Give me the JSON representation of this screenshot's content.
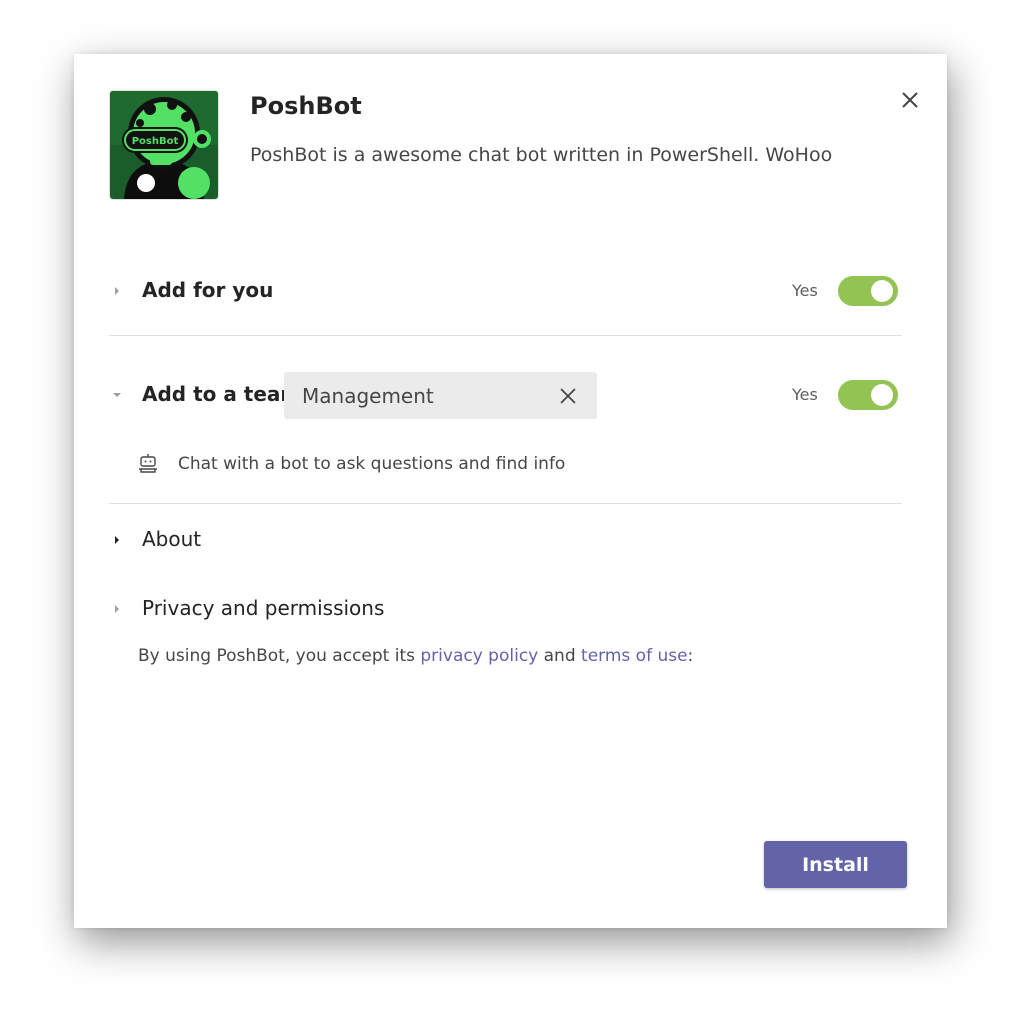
{
  "app": {
    "name": "PoshBot",
    "description": "PoshBot is a awesome chat bot written in PowerShell. WoHoo",
    "logo_text": "PoshBot",
    "logo_icon": "robot-avatar-icon"
  },
  "close": {
    "icon": "close-icon"
  },
  "sections": {
    "add_for_you": {
      "label": "Add for you",
      "toggle_label": "Yes",
      "toggle_on": true,
      "expanded": false
    },
    "add_to_team": {
      "label": "Add to a team",
      "selected_team": "Management",
      "toggle_label": "Yes",
      "toggle_on": true,
      "expanded": true,
      "info_icon": "bot-icon",
      "info_text": "Chat with a bot to ask questions and find info"
    },
    "about": {
      "label": "About",
      "expanded": false
    },
    "privacy": {
      "label": "Privacy and permissions",
      "expanded": false
    }
  },
  "legal": {
    "prefix": "By using PoshBot, you accept its ",
    "privacy_link": "privacy policy",
    "middle": " and ",
    "terms_link": "terms of use",
    "suffix": ":"
  },
  "install_label": "Install",
  "colors": {
    "accent": "#6264a7",
    "toggle_on": "#92c353",
    "logo_green": "#4cd964",
    "logo_bg": "#1a5c2a"
  }
}
